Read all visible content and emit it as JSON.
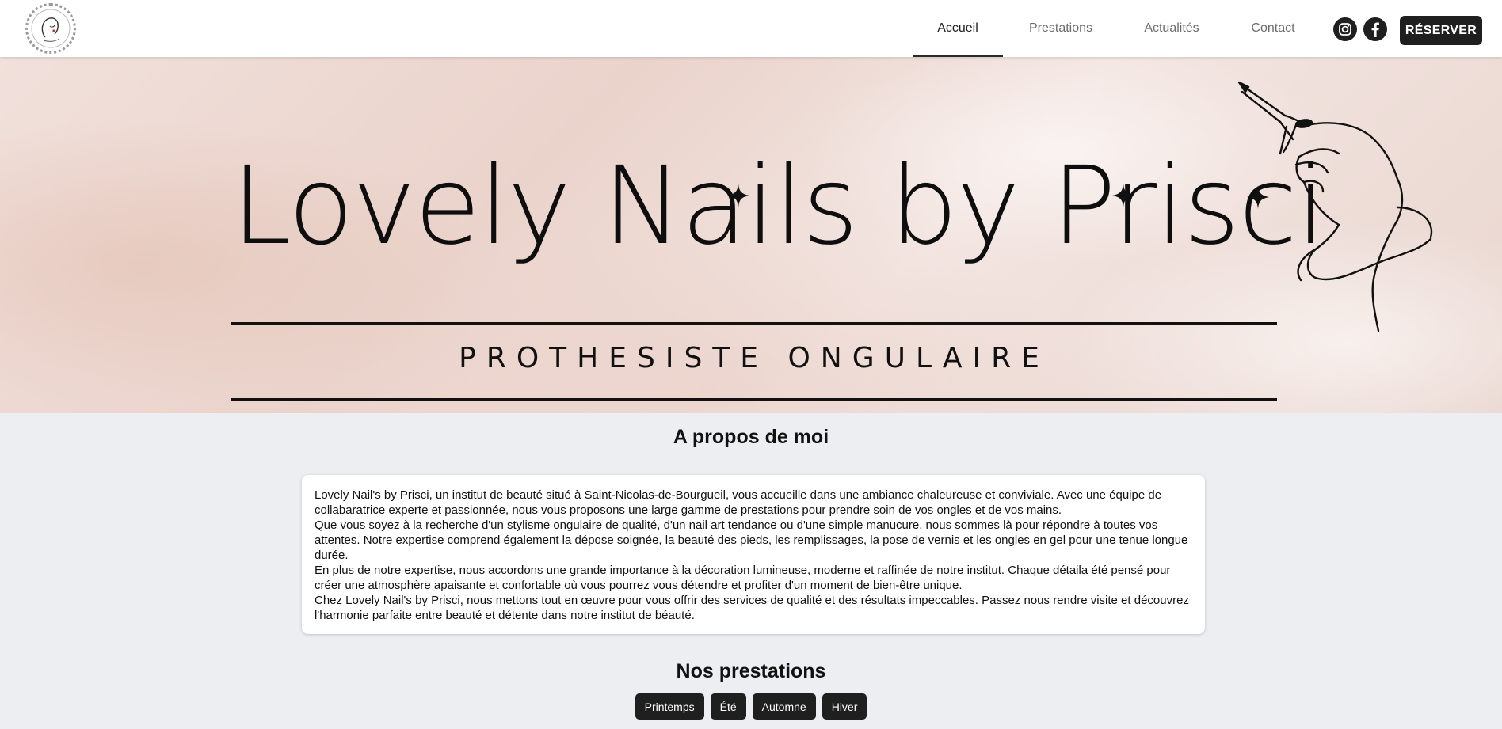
{
  "header": {
    "logo_icon": "logo-emblem-icon",
    "nav": [
      {
        "label": "Accueil",
        "active": true
      },
      {
        "label": "Prestations",
        "active": false
      },
      {
        "label": "Actualités",
        "active": false
      },
      {
        "label": "Contact",
        "active": false
      }
    ],
    "social": [
      "instagram-icon",
      "facebook-icon"
    ],
    "reserve_label": "RÉSERVER"
  },
  "hero": {
    "title": "Lovely Nails by Prisci",
    "subtitle": "PROTHESISTE ONGULAIRE",
    "illustration_icon": "hand-nail-illustration-icon"
  },
  "about": {
    "heading": "A propos de moi",
    "paragraphs": [
      "Lovely Nail's by Prisci, un institut de beauté situé à Saint-Nicolas-de-Bourgueil, vous accueille dans une ambiance chaleureuse et conviviale. Avec une équipe de collabaratrice experte et passionnée, nous vous proposons une large gamme de prestations pour prendre soin de vos ongles et de vos mains.",
      "Que vous soyez à la recherche d'un stylisme ongulaire de qualité, d'un nail art tendance ou d'une simple manucure, nous sommes là pour répondre à toutes vos attentes. Notre expertise comprend également la dépose soignée, la beauté des pieds, les remplissages, la pose de vernis et les ongles en gel pour une tenue longue durée.",
      "En plus de notre expertise, nous accordons une grande importance à la décoration lumineuse, moderne et raffinée de notre institut. Chaque détaila été pensé pour créer une atmosphère apaisante et confortable où vous pourrez vous détendre et profiter d'un moment de bien-être unique.",
      "Chez Lovely Nail's by Prisci, nous mettons tout en œuvre pour vous offrir des services de qualité et des résultats impeccables. Passez nous rendre visite et découvrez l'harmonie parfaite entre beauté et détente dans notre institut de béauté."
    ]
  },
  "prestations": {
    "heading": "Nos prestations",
    "seasons": [
      "Printemps",
      "Été",
      "Automne",
      "Hiver"
    ]
  },
  "colors": {
    "header_bg": "#ffffff",
    "page_bg": "#edeef1",
    "button_bg": "#1f1f1f",
    "hero_tint": "#ead3cb"
  }
}
